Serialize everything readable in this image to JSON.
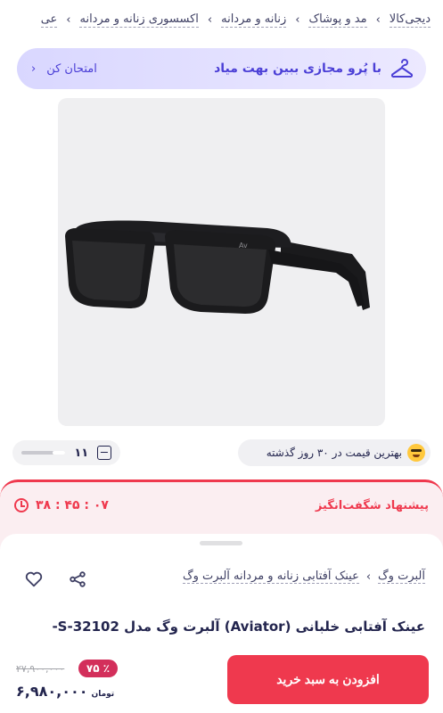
{
  "breadcrumb": {
    "items": [
      "دیجی‌کالا",
      "مد و پوشاک",
      "زنانه و مردانه",
      "اکسسوری زنانه و مردانه",
      "عی"
    ],
    "separator": "‹"
  },
  "tryon": {
    "text": "با پُرو مجازی ببین بهت میاد",
    "cta": "امتحان کن",
    "chevron": "‹",
    "icon": "hanger-icon"
  },
  "product_image": {
    "description_icon": "sunglasses-image"
  },
  "gallery": {
    "count": "۱۱",
    "icon": "gallery-icon"
  },
  "best_price": {
    "text": "بهترین قیمت در ۳۰ روز گذشته",
    "icon": "star-struck-emoji-icon"
  },
  "amazing_offer": {
    "title": "پیشنهاد شگفت‌انگیز",
    "timer": "۳۸ : ۴۵ : ۰۷",
    "color": "#ef394e"
  },
  "category_links": {
    "brand": "آلبرت وگ",
    "category": "عینک آفتابی زنانه و مردانه آلبرت وگ",
    "separator": "‹"
  },
  "product": {
    "title": "عینک آفتابی خلبانی (Aviator) آلبرت وگ مدل S-32102-"
  },
  "buy_bar": {
    "add_to_cart": "افزودن به سبد خرید",
    "old_price": "۲۷,۹۰۰,۰۰۰",
    "discount": "۷۵ ٪",
    "price": "۶,۹۸۰,۰۰۰",
    "currency": "تومان",
    "accent": "#ef394e"
  }
}
